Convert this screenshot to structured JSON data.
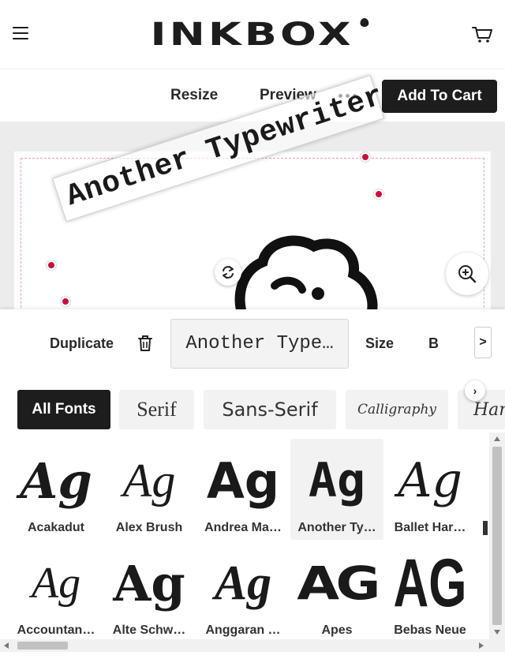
{
  "header": {
    "logo": "INKBOX",
    "menu_icon": "hamburger-icon",
    "cart_icon": "cart-icon"
  },
  "toolbar": {
    "resize": "Resize",
    "preview": "Preview",
    "more_icon": "more-dots-icon",
    "add_to_cart": "Add To Cart"
  },
  "canvas": {
    "text": "Another Typewriter",
    "rotate_icon": "rotate-icon",
    "zoom_icon": "zoom-in-icon"
  },
  "properties": {
    "duplicate": "Duplicate",
    "delete_icon": "trash-icon",
    "font_value": "Another Type…",
    "size": "Size",
    "bold": "B",
    "next": ">"
  },
  "categories": {
    "all": "All Fonts",
    "serif": "Serif",
    "sans": "Sans-Serif",
    "calligraphy": "Calligraphy",
    "handwritten": "Han",
    "next_icon": "chevron-right-icon"
  },
  "fonts": {
    "sample": "Ag",
    "sample_caps": "AG",
    "items": [
      {
        "name": "Acakadut"
      },
      {
        "name": "Alex Brush"
      },
      {
        "name": "Andrea Ma…"
      },
      {
        "name": "Another Ty…"
      },
      {
        "name": "Ballet Har…"
      },
      {
        "name": "Accountan…"
      },
      {
        "name": "Alte Schw…"
      },
      {
        "name": "Anggaran …"
      },
      {
        "name": "Apes"
      },
      {
        "name": "Bebas Neue"
      }
    ]
  },
  "colors": {
    "accent": "#c8103e",
    "dark": "#1d1d1d"
  }
}
